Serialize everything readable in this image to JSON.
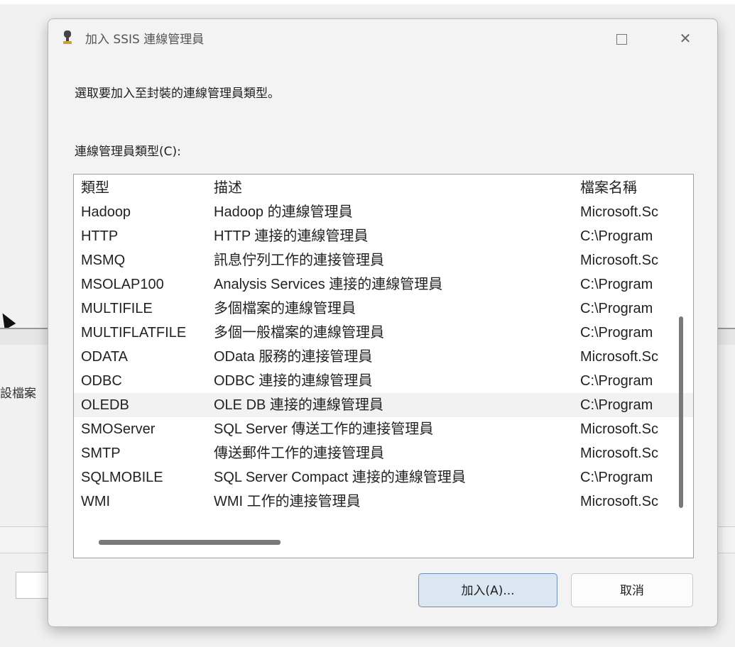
{
  "background": {
    "left_label": "設檔案"
  },
  "dialog": {
    "title": "加入 SSIS 連線管理員",
    "maximize_glyph": "□",
    "close_glyph": "✕",
    "instruction": "選取要加入至封裝的連線管理員類型。",
    "list_label": "連線管理員類型(C):",
    "columns": {
      "type": "類型",
      "description": "描述",
      "filename": "檔案名稱"
    },
    "rows": [
      {
        "type": "Hadoop",
        "description": "Hadoop 的連線管理員",
        "filename": "Microsoft.Sc"
      },
      {
        "type": "HTTP",
        "description": "HTTP 連接的連線管理員",
        "filename": "C:\\Program"
      },
      {
        "type": "MSMQ",
        "description": "訊息佇列工作的連接管理員",
        "filename": "Microsoft.Sc"
      },
      {
        "type": "MSOLAP100",
        "description": "Analysis Services 連接的連線管理員",
        "filename": "C:\\Program"
      },
      {
        "type": "MULTIFILE",
        "description": "多個檔案的連線管理員",
        "filename": "C:\\Program"
      },
      {
        "type": "MULTIFLATFILE",
        "description": "多個一般檔案的連線管理員",
        "filename": "C:\\Program"
      },
      {
        "type": "ODATA",
        "description": "OData 服務的連接管理員",
        "filename": "Microsoft.Sc"
      },
      {
        "type": "ODBC",
        "description": "ODBC 連接的連線管理員",
        "filename": "C:\\Program"
      },
      {
        "type": "OLEDB",
        "description": "OLE DB 連接的連線管理員",
        "filename": "C:\\Program",
        "selected": true
      },
      {
        "type": "SMOServer",
        "description": "SQL Server 傳送工作的連接管理員",
        "filename": "Microsoft.Sc"
      },
      {
        "type": "SMTP",
        "description": "傳送郵件工作的連接管理員",
        "filename": "Microsoft.Sc"
      },
      {
        "type": "SQLMOBILE",
        "description": "SQL Server Compact 連接的連線管理員",
        "filename": "C:\\Program"
      },
      {
        "type": "WMI",
        "description": "WMI 工作的連接管理員",
        "filename": "Microsoft.Sc"
      }
    ],
    "add_button": "加入(A)...",
    "cancel_button": "取消"
  },
  "colors": {
    "dialog_bg": "#f3f3f3",
    "list_bg": "#ffffff",
    "selected_row": "#f2f2f2",
    "add_button_bg": "#dbe6f3",
    "add_button_border": "#6f8fb5",
    "scrollbar": "#7a7a7a"
  },
  "icons": {
    "title": "connection-plug-icon",
    "maximize": "maximize-icon",
    "close": "close-icon"
  }
}
